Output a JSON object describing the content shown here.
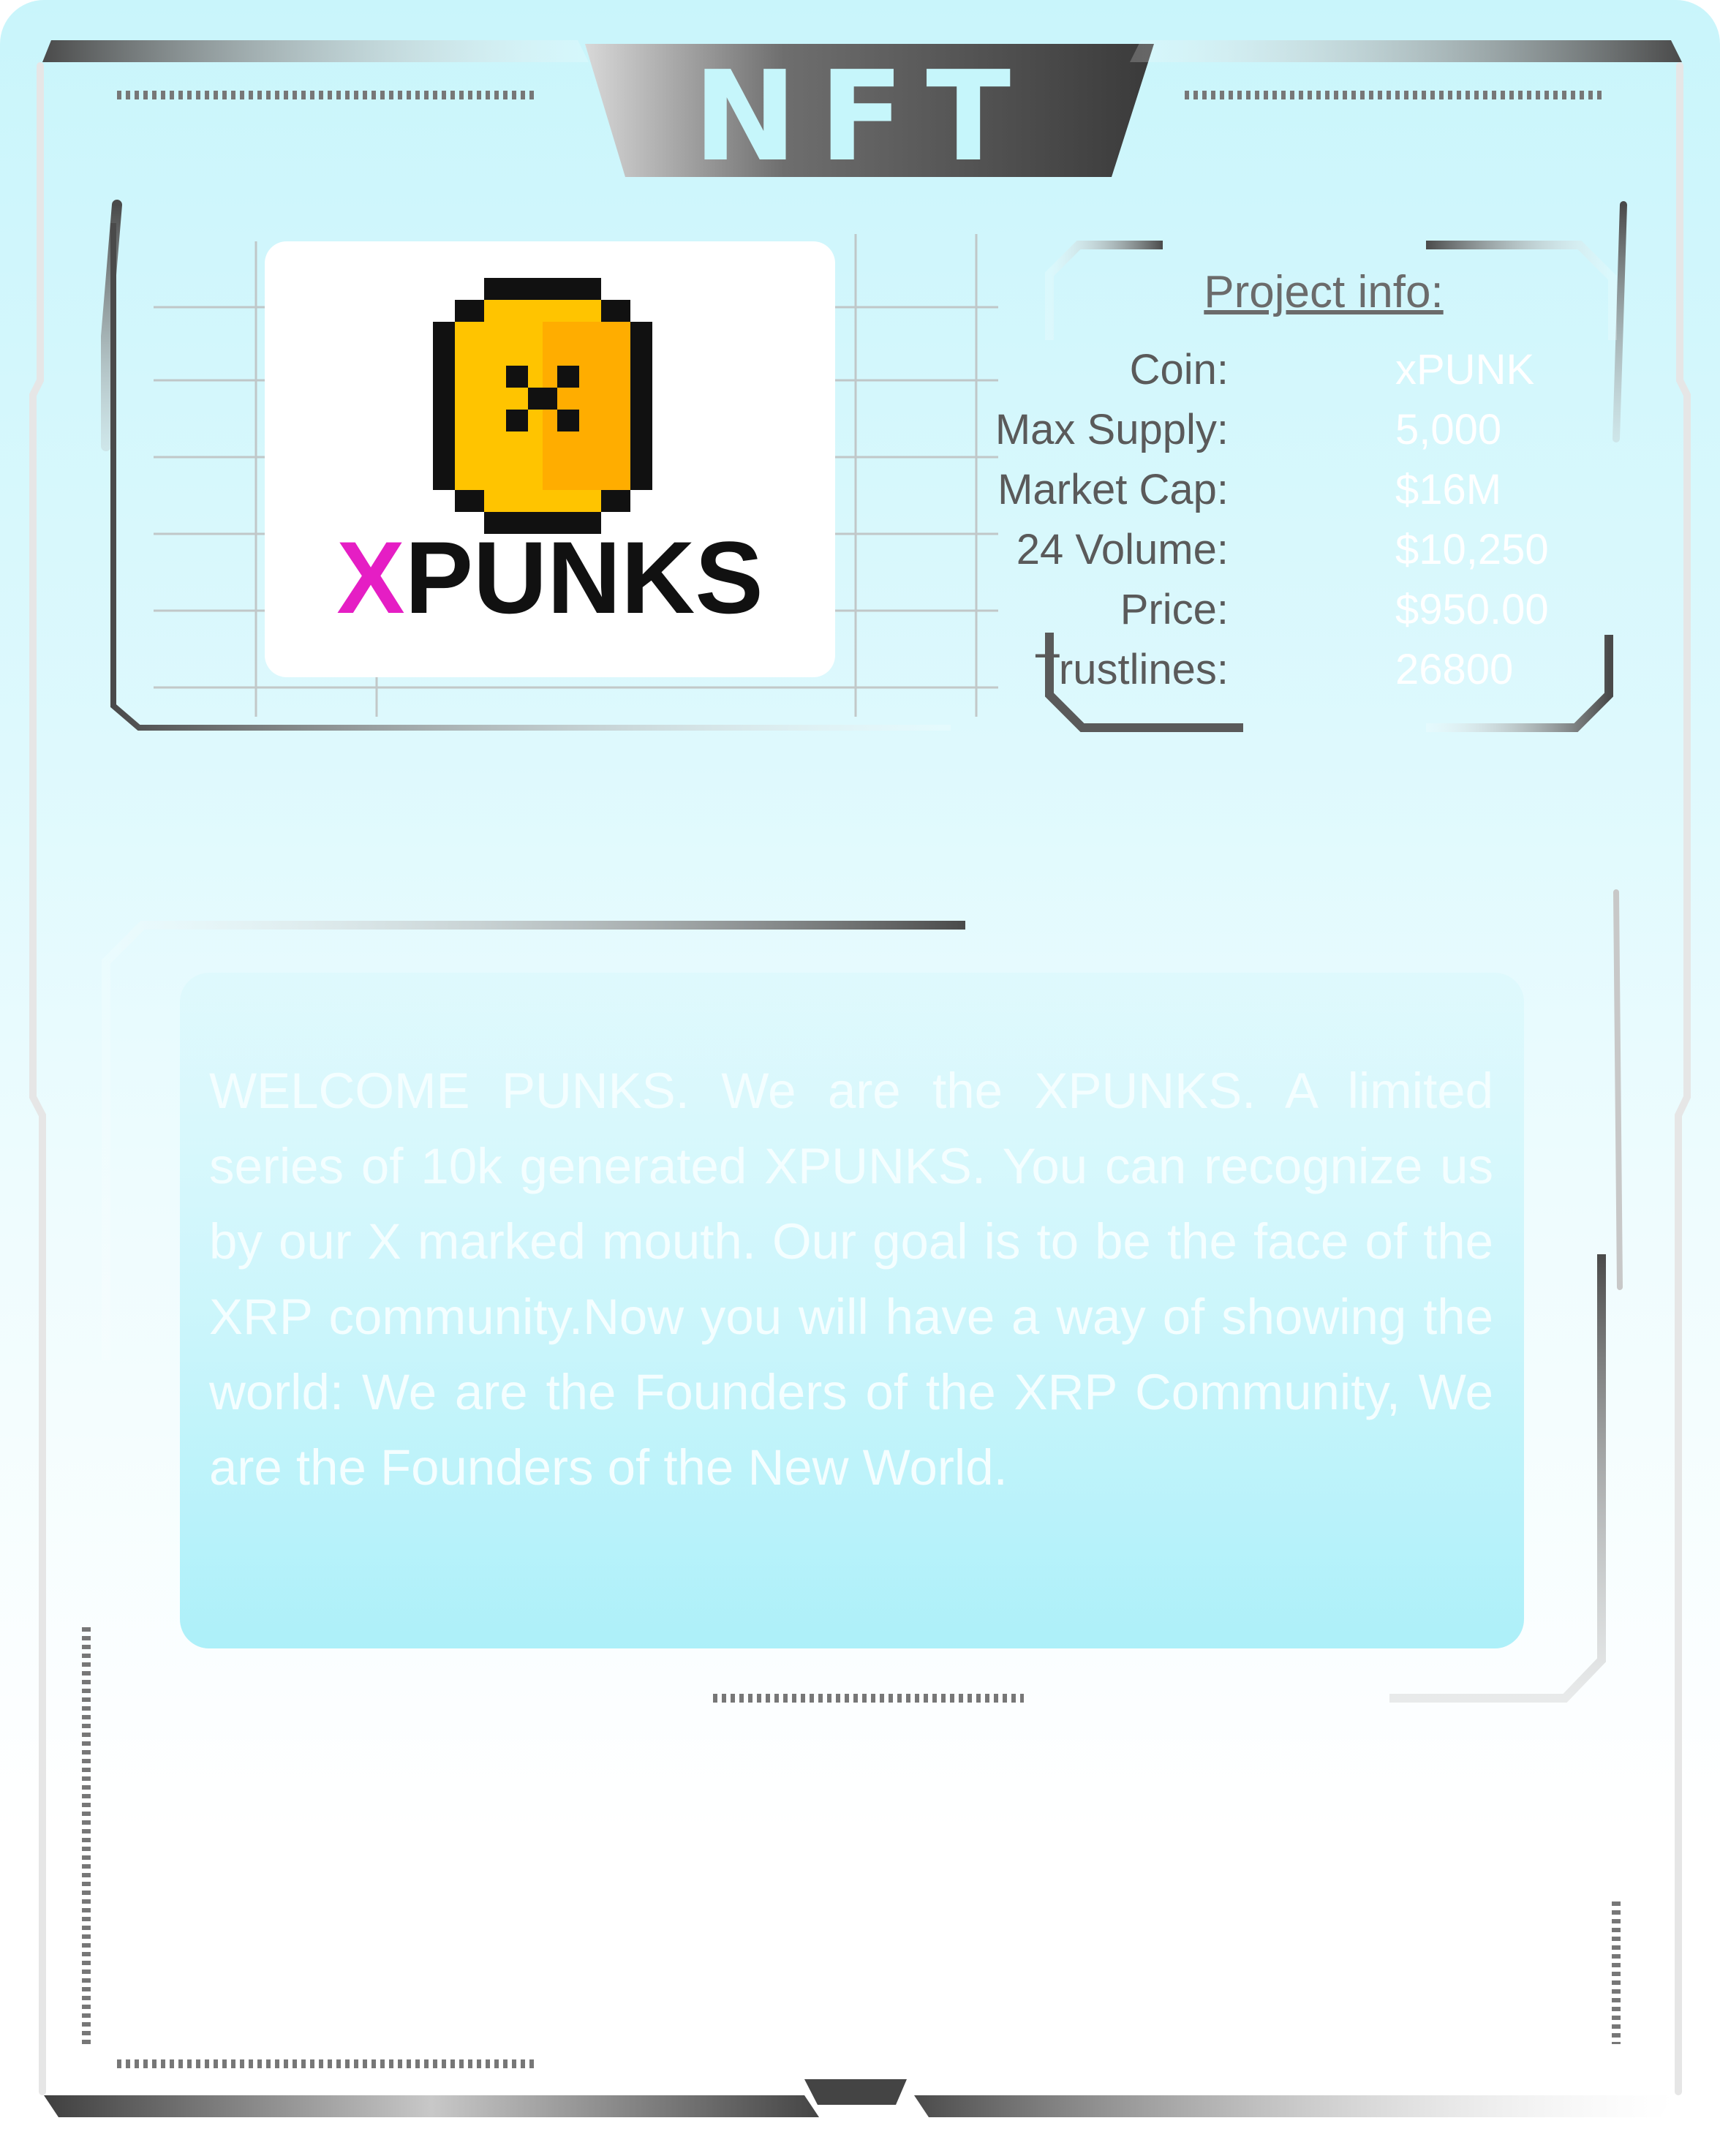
{
  "card": {
    "title": "NFT",
    "logo": {
      "x_letter": "X",
      "rest": "PUNKS"
    },
    "project_info": {
      "heading": "Project info:",
      "rows": [
        {
          "label": "Coin:",
          "value": "xPUNK"
        },
        {
          "label": "Max Supply:",
          "value": "5,000"
        },
        {
          "label": "Market Cap:",
          "value": "$16M"
        },
        {
          "label": "24 Volume:",
          "value": "$10,250"
        },
        {
          "label": "Price:",
          "value": "$950.00"
        },
        {
          "label": "Trustlines:",
          "value": "26800"
        }
      ]
    },
    "description": "WELCOME PUNKS. We are the XPUNKS. A limited series of 10k generated XPUNKS. You can recognize us by our X marked mouth. Our goal is to be the face of the XRP community.Now you will have a way of showing the world: We are the Founders  of the XRP Community, We are the Founders of the New World."
  },
  "colors": {
    "card_top": "#c9f5fb",
    "frame_dark": "#4a4a4a",
    "frame_light": "#d0d0d0",
    "title_text": "#c6f6fb",
    "logo_x": "#e51ec4",
    "coin_yellow": "#ffc400",
    "coin_orange": "#ff9a00",
    "info_label": "#5a5a5a",
    "info_value": "#ffffff",
    "desc_text": "#f4feff"
  },
  "icons": {
    "logo_coin": "pixel-coin-x-icon"
  }
}
